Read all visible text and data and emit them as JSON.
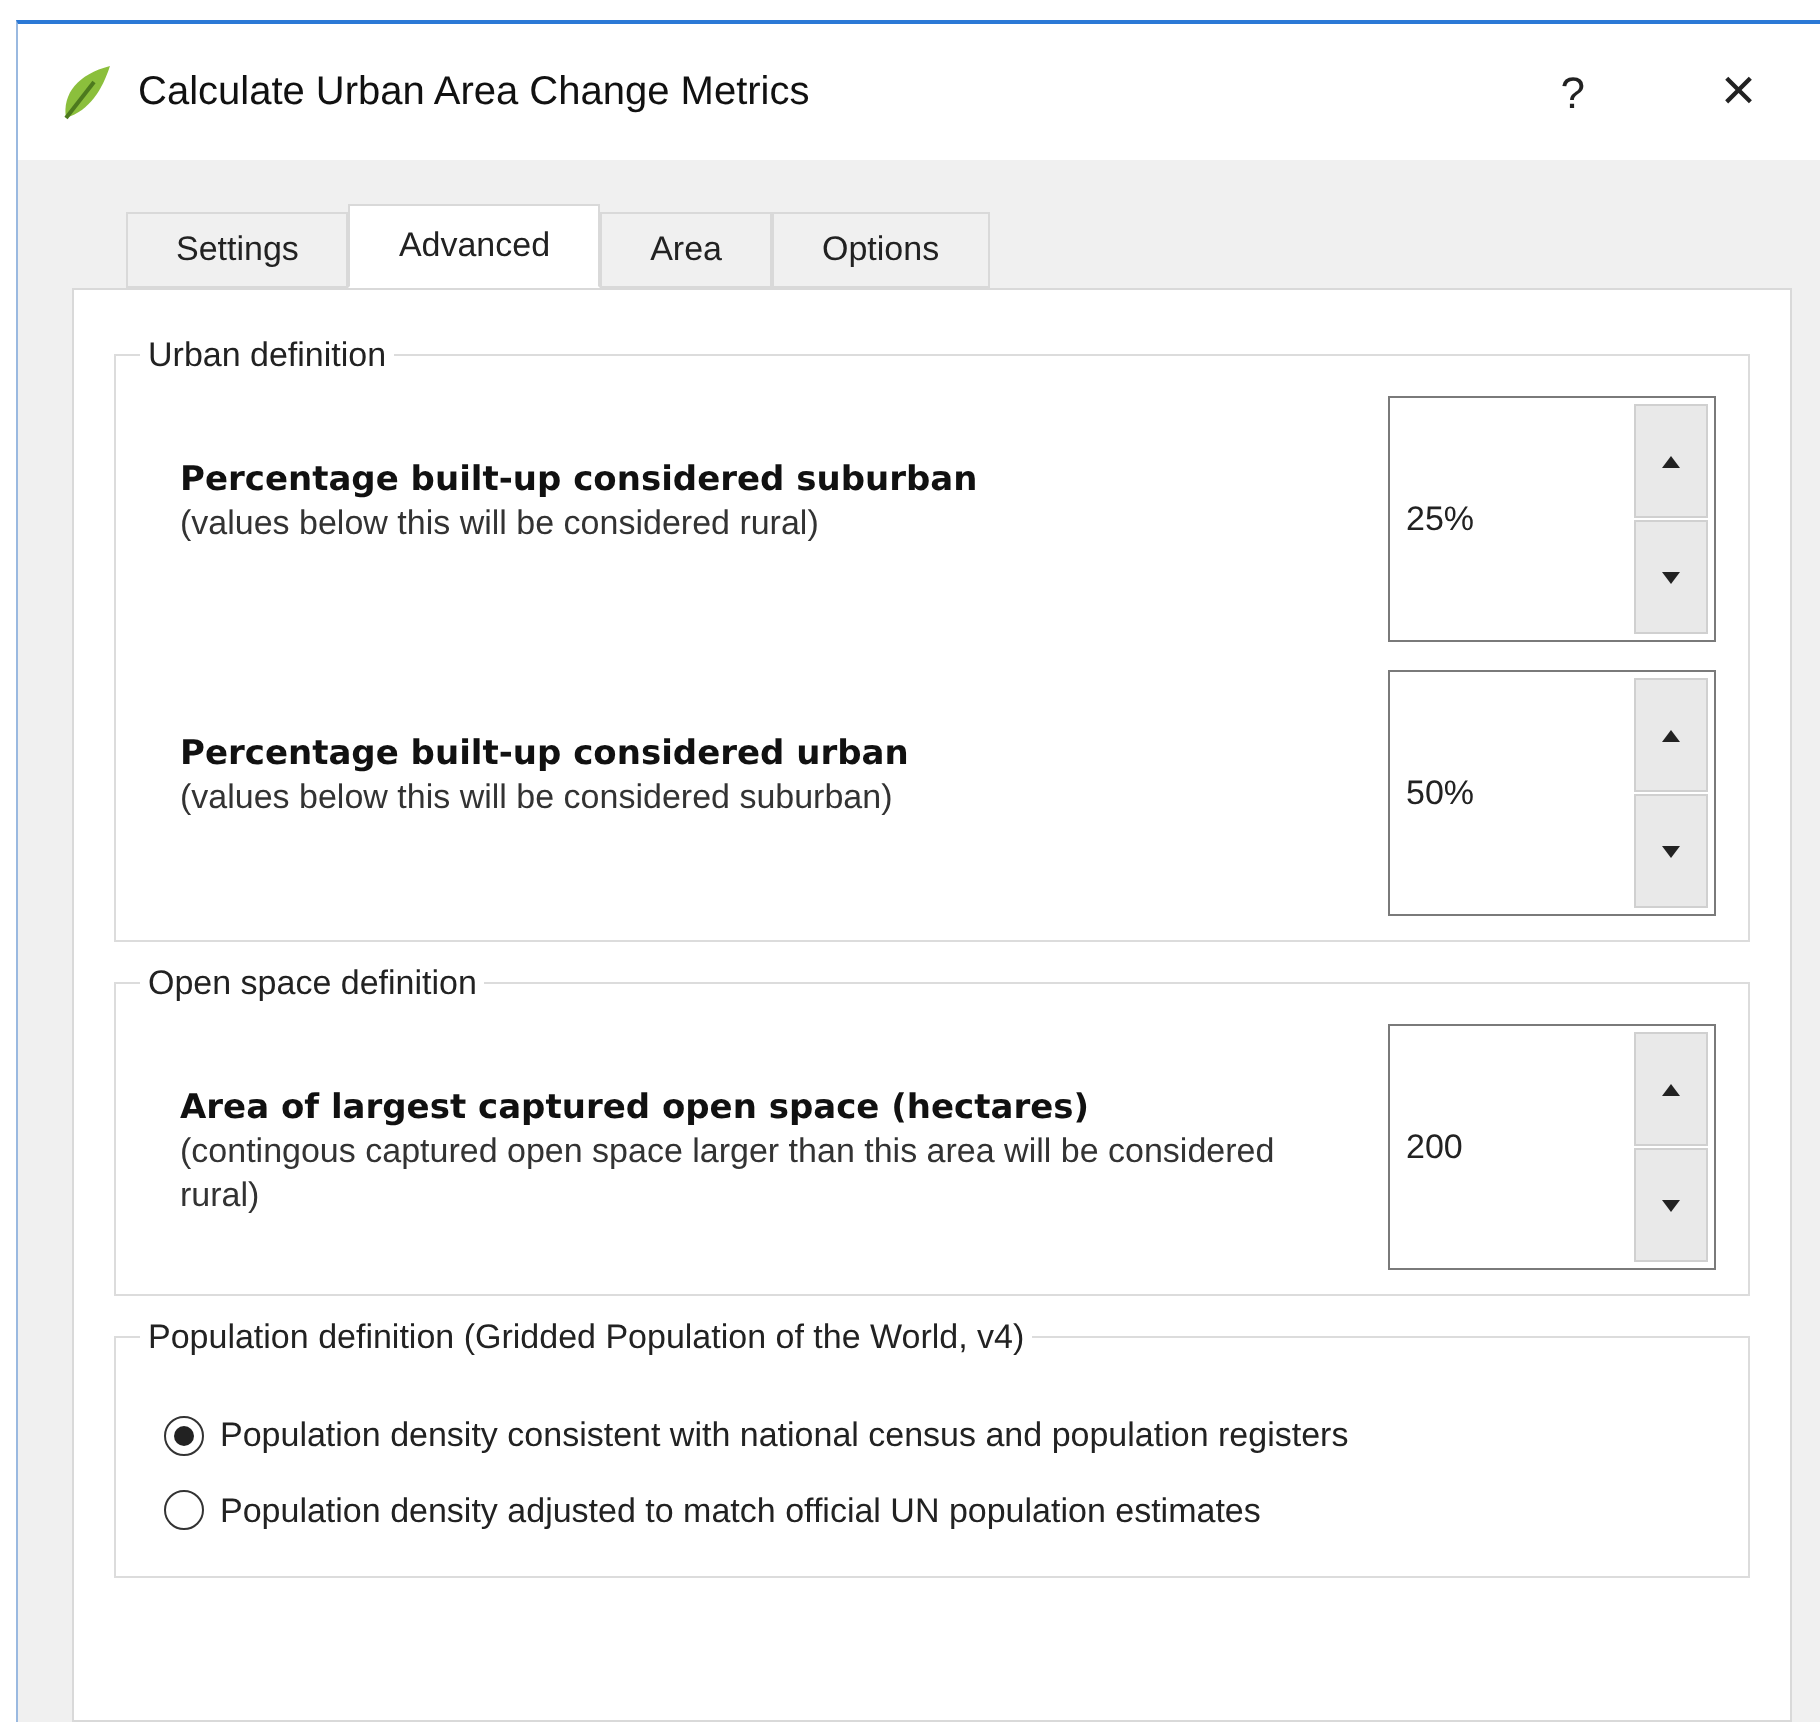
{
  "window": {
    "title": "Calculate Urban Area Change Metrics",
    "help": "?",
    "close": "×"
  },
  "tabs": [
    {
      "label": "Settings",
      "selected": false
    },
    {
      "label": "Advanced",
      "selected": true
    },
    {
      "label": "Area",
      "selected": false
    },
    {
      "label": "Options",
      "selected": false
    }
  ],
  "groups": [
    {
      "title": "Urban definition",
      "kind": "spin",
      "fields": [
        {
          "label": "Percentage built-up considered suburban",
          "hint": "(values below this will be considered rural)",
          "value": "25%"
        },
        {
          "label": "Percentage built-up considered urban",
          "hint": "(values below this will be considered suburban)",
          "value": "50%"
        }
      ]
    },
    {
      "title": "Open space definition",
      "kind": "spin",
      "fields": [
        {
          "label": "Area of largest captured open space (hectares)",
          "hint": "(contingous captured open space larger than this area will be considered rural)",
          "value": "200"
        }
      ]
    },
    {
      "title": "Population definition (Gridded Population of the World, v4)",
      "kind": "radio",
      "options": [
        {
          "label": "Population density consistent with national census and population registers",
          "selected": true
        },
        {
          "label": "Population density adjusted to match official UN population estimates",
          "selected": false
        }
      ]
    }
  ]
}
